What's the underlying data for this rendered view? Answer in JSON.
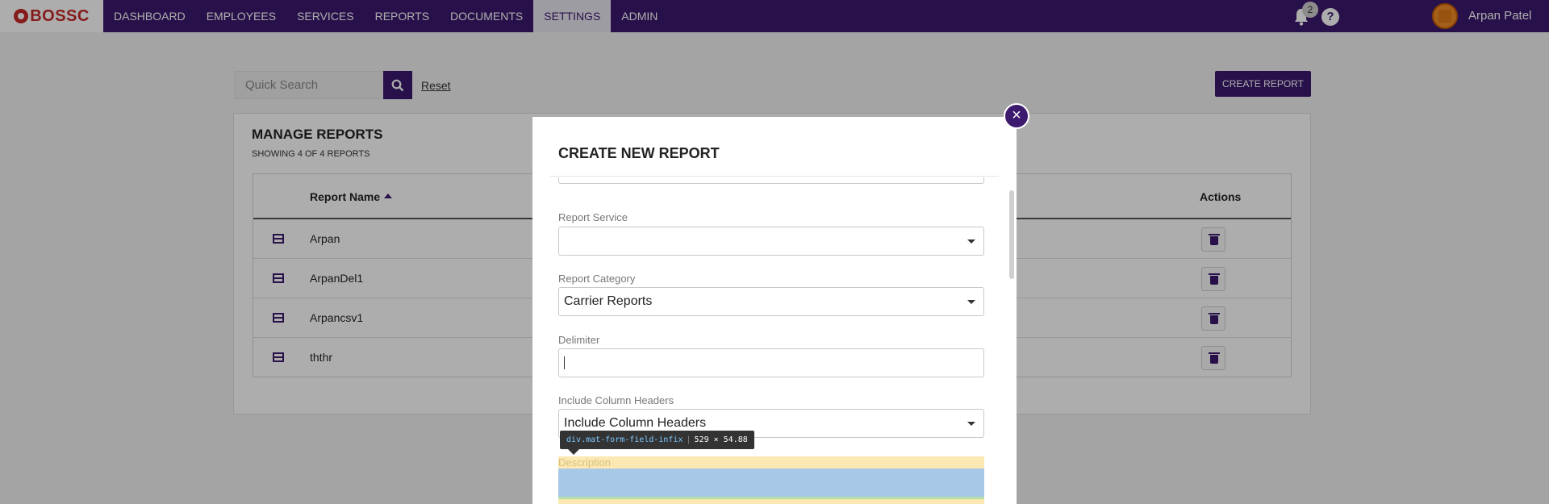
{
  "brand": {
    "name": "BOSSC"
  },
  "nav": {
    "items": [
      {
        "label": "DASHBOARD"
      },
      {
        "label": "EMPLOYEES"
      },
      {
        "label": "SERVICES"
      },
      {
        "label": "REPORTS"
      },
      {
        "label": "DOCUMENTS"
      },
      {
        "label": "SETTINGS",
        "active": true
      },
      {
        "label": "ADMIN"
      }
    ]
  },
  "header": {
    "notification_count": "2",
    "help_symbol": "?",
    "user_name": "Arpan Patel"
  },
  "search": {
    "placeholder": "Quick Search",
    "reset_label": "Reset"
  },
  "toolbar": {
    "create_label": "CREATE REPORT"
  },
  "reports": {
    "title": "MANAGE REPORTS",
    "subtitle": "SHOWING 4 OF 4 REPORTS",
    "columns": {
      "name": "Report Name",
      "actions": "Actions"
    },
    "rows": [
      {
        "name": "Arpan"
      },
      {
        "name": "ArpanDel1"
      },
      {
        "name": "Arpancsv1"
      },
      {
        "name": "ththr"
      }
    ]
  },
  "modal": {
    "title": "CREATE NEW REPORT",
    "close_symbol": "×",
    "fields": {
      "service": {
        "label": "Report Service",
        "value": ""
      },
      "category": {
        "label": "Report Category",
        "value": "Carrier Reports"
      },
      "delimiter": {
        "label": "Delimiter",
        "value": ""
      },
      "column_headers": {
        "label": "Include Column Headers",
        "value": "Include Column Headers"
      },
      "description": {
        "label": "Description"
      }
    }
  },
  "devtools_tooltip": {
    "tag": "div",
    "selector": ".mat-form-field-infix",
    "dimensions": "529 × 54.88"
  },
  "colors": {
    "brand_purple": "#3c1a6e",
    "logo_red": "#c62828",
    "highlight_padding": "#fce8b2",
    "highlight_content": "#a8c8e8"
  },
  "icons": {
    "bell": "bell-icon",
    "help": "help-icon",
    "search": "search-icon",
    "row": "table-icon",
    "delete": "trash-icon",
    "close": "close-icon",
    "dropdown": "chevron-down-icon"
  }
}
